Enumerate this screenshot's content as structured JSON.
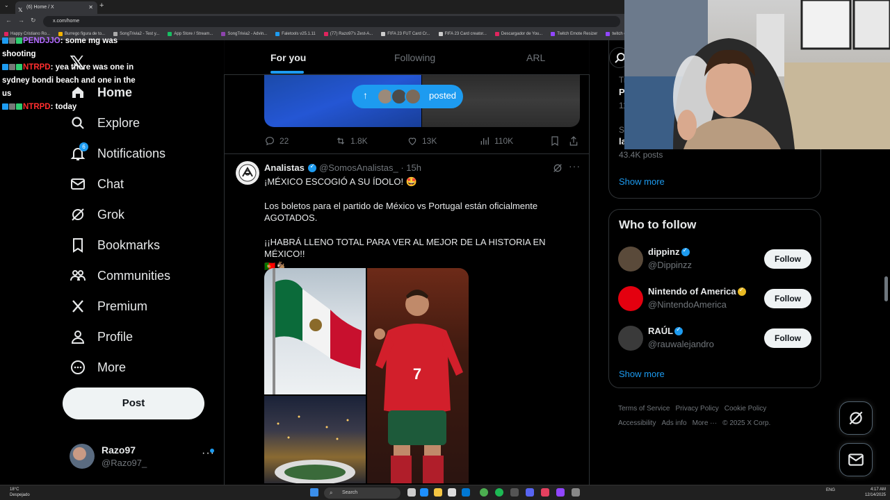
{
  "browser": {
    "tab_title": "(6) Home / X",
    "url": "x.com/home",
    "bookmarks": [
      "Happy Cristiano Ro...",
      "Burrego figura de to...",
      "SongTrivia2 - Test y...",
      "App Store / Stream...",
      "SongTrivia2 - Advin...",
      "Faletools v25.1.11",
      "(77) Razo97's Zest-A...",
      "FIFA 23 FUT Card Cr...",
      "FIFA 23 Card creator...",
      "Descargador de You...",
      "Twitch Emote Resizer",
      "twitch em"
    ],
    "bookmark_colors": [
      "#e0245e",
      "#f4b400",
      "#aaaaaa",
      "#17bf63",
      "#8e44ad",
      "#1d9bf0",
      "#e0245e",
      "#cccccc",
      "#cccccc",
      "#e0245e",
      "#9146ff",
      "#9146ff"
    ]
  },
  "chat": [
    {
      "user": "PENDJJO",
      "color": "purple",
      "message": ": some mg was shooting"
    },
    {
      "user": "NTRPD",
      "color": "red",
      "message": ": yea there was one in sydney bondi beach and one in the us"
    },
    {
      "user": "NTRPD",
      "color": "red",
      "message": ": today"
    }
  ],
  "nav": {
    "items": [
      {
        "label": "Home",
        "icon": "home-icon"
      },
      {
        "label": "Explore",
        "icon": "search-icon"
      },
      {
        "label": "Notifications",
        "icon": "bell-icon",
        "badge": "6"
      },
      {
        "label": "Chat",
        "icon": "mail-icon"
      },
      {
        "label": "Grok",
        "icon": "grok-icon"
      },
      {
        "label": "Bookmarks",
        "icon": "bookmark-icon"
      },
      {
        "label": "Communities",
        "icon": "communities-icon"
      },
      {
        "label": "Premium",
        "icon": "x-icon"
      },
      {
        "label": "Profile",
        "icon": "person-icon"
      },
      {
        "label": "More",
        "icon": "more-circle-icon"
      }
    ],
    "post_label": "Post"
  },
  "profile": {
    "name": "Razo97",
    "handle": "@Razo97_"
  },
  "feed": {
    "tabs": [
      "For you",
      "Following",
      "ARL"
    ],
    "active_tab": "For you",
    "posted_label": "posted",
    "prev_post_stats": {
      "replies": "22",
      "reposts": "1.8K",
      "likes": "13K",
      "views": "110K"
    },
    "tweet": {
      "name": "Analistas",
      "handle": "@SomosAnalistas_",
      "time": "· 15h",
      "line1": "¡MÉXICO ESCOGIÓ A SU ÍDOLO! 🤩",
      "line2": "Los boletos para el partido de México vs Portugal están oficialmente AGOTADOS.",
      "line3": "¡¡HABRÁ LLENO TOTAL PARA VER AL MEJOR DE LA HISTORIA EN MÉXICO!!",
      "line4": "🇵🇹🐐",
      "jersey_number": "7"
    }
  },
  "right": {
    "trends": [
      {
        "meta": "Tr",
        "title": "P",
        "count": "11"
      },
      {
        "meta": "S",
        "title": "la",
        "count": "43.4K posts"
      }
    ],
    "show_more": "Show more",
    "who_to_follow_title": "Who to follow",
    "follow_label": "Follow",
    "suggestions": [
      {
        "name": "dippinz",
        "handle": "@Dippinzz",
        "badge_color": "#1d9bf0",
        "avatar_color": "#5a4a3a"
      },
      {
        "name": "Nintendo of America",
        "handle": "@NintendoAmerica",
        "badge_color": "#e8b923",
        "avatar_color": "#e4000f"
      },
      {
        "name": "RAÚL",
        "handle": "@rauwalejandro",
        "badge_color": "#1d9bf0",
        "avatar_color": "#3a3a3a"
      }
    ],
    "footer": [
      "Terms of Service",
      "Privacy Policy",
      "Cookie Policy",
      "Accessibility",
      "Ads info",
      "More ···",
      "© 2025 X Corp."
    ]
  },
  "taskbar": {
    "weather_temp": "18°C",
    "weather_desc": "Despejado",
    "search_label": "Search",
    "lang": "ENG",
    "time": "4:17 AM",
    "date": "12/14/2025"
  }
}
